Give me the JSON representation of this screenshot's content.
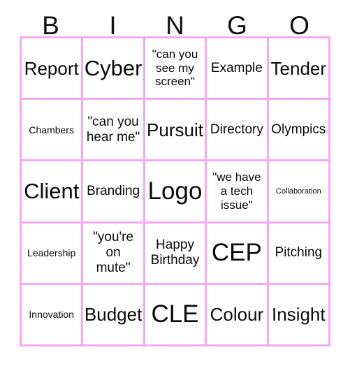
{
  "card": {
    "title": "BINGO",
    "grid_color": "#f7a8f2",
    "text_color": "#0a0a0a",
    "background_color": "#ffffff",
    "columns": 5,
    "rows": 5
  },
  "header": {
    "letters": [
      "B",
      "I",
      "N",
      "G",
      "O"
    ]
  },
  "cells": [
    {
      "text": "Report",
      "size": "xl",
      "row": 1,
      "col": "B"
    },
    {
      "text": "Cyber",
      "size": "xxl",
      "row": 1,
      "col": "I"
    },
    {
      "text": "\"can you\nsee my\nscreen\"",
      "size": "m",
      "row": 1,
      "col": "N"
    },
    {
      "text": "Example",
      "size": "ml",
      "row": 1,
      "col": "G"
    },
    {
      "text": "Tender",
      "size": "xl",
      "row": 1,
      "col": "O"
    },
    {
      "text": "Chambers",
      "size": "s",
      "row": 2,
      "col": "B"
    },
    {
      "text": "\"can you\nhear me\"",
      "size": "ml",
      "row": 2,
      "col": "I"
    },
    {
      "text": "Pursuit",
      "size": "xl",
      "row": 2,
      "col": "N"
    },
    {
      "text": "Directory",
      "size": "ml",
      "row": 2,
      "col": "G"
    },
    {
      "text": "Olympics",
      "size": "ml",
      "row": 2,
      "col": "O"
    },
    {
      "text": "Client",
      "size": "xxl",
      "row": 3,
      "col": "B"
    },
    {
      "text": "Branding",
      "size": "ml",
      "row": 3,
      "col": "I"
    },
    {
      "text": "Logo",
      "size": "huge",
      "row": 3,
      "col": "N"
    },
    {
      "text": "\"we have\na tech\nissue\"",
      "size": "m",
      "row": 3,
      "col": "G"
    },
    {
      "text": "Collaboration",
      "size": "xs",
      "row": 3,
      "col": "O"
    },
    {
      "text": "Leadership",
      "size": "s",
      "row": 4,
      "col": "B"
    },
    {
      "text": "\"you're\non\nmute\"",
      "size": "ml",
      "row": 4,
      "col": "I"
    },
    {
      "text": "Happy\nBirthday",
      "size": "ml",
      "row": 4,
      "col": "N"
    },
    {
      "text": "CEP",
      "size": "huge",
      "row": 4,
      "col": "G"
    },
    {
      "text": "Pitching",
      "size": "ml",
      "row": 4,
      "col": "O"
    },
    {
      "text": "Innovation",
      "size": "s",
      "row": 5,
      "col": "B"
    },
    {
      "text": "Budget",
      "size": "xl",
      "row": 5,
      "col": "I"
    },
    {
      "text": "CLE",
      "size": "huge",
      "row": 5,
      "col": "N"
    },
    {
      "text": "Colour",
      "size": "xl",
      "row": 5,
      "col": "G"
    },
    {
      "text": "Insight",
      "size": "xl",
      "row": 5,
      "col": "O"
    }
  ]
}
